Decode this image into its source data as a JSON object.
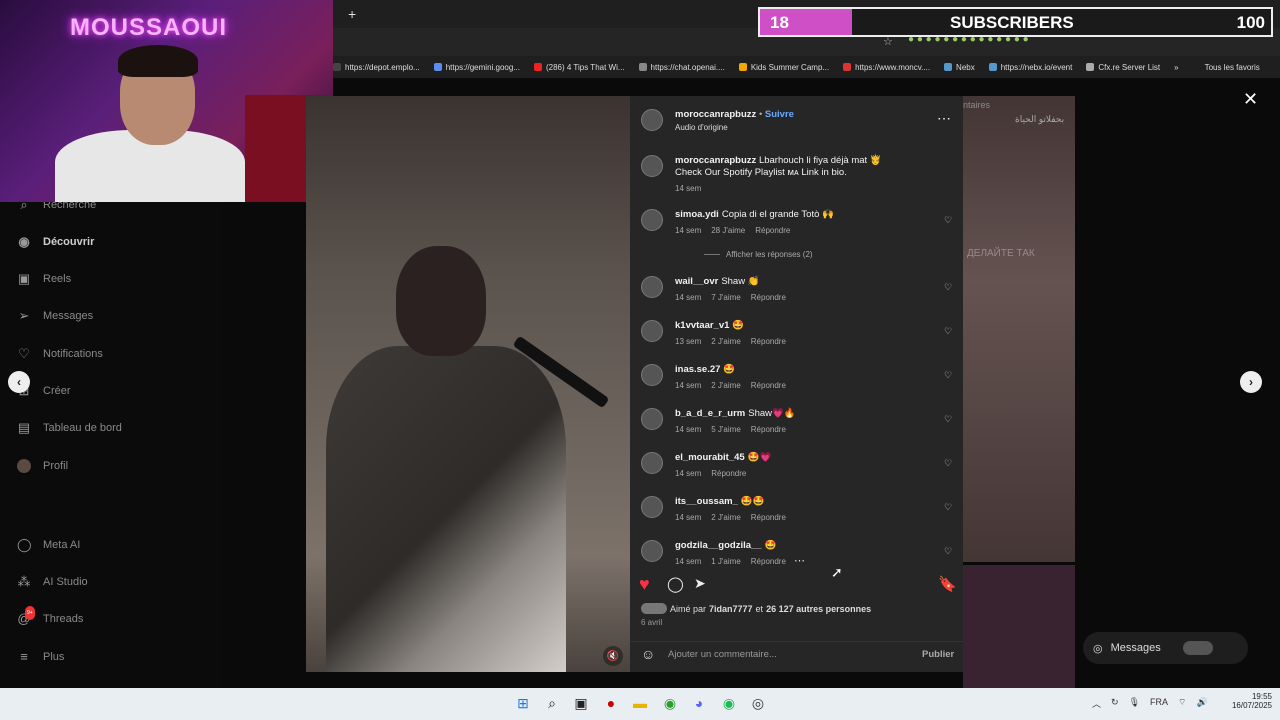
{
  "browser": {
    "new_tab": "+",
    "bookmarks": [
      {
        "label": "https://depot.emplo...",
        "color": "#444"
      },
      {
        "label": "https://gemini.goog...",
        "color": "#5b8def"
      },
      {
        "label": "(286) 4 Tips That Wi...",
        "color": "#e22"
      },
      {
        "label": "https://chat.openai....",
        "color": "#888"
      },
      {
        "label": "Kids Summer Camp...",
        "color": "#f0a800"
      },
      {
        "label": "https://www.moncv....",
        "color": "#d33"
      },
      {
        "label": "Nebx",
        "color": "#59c"
      },
      {
        "label": "https://nebx.io/event",
        "color": "#59c"
      },
      {
        "label": "Cfx.re Server List",
        "color": "#aaa"
      }
    ],
    "more_bookmarks": "»",
    "all_favorites": "Tous les favoris"
  },
  "overlay": {
    "streamer_name": "MOUSSAOUI",
    "subs_current": "18",
    "subs_label": "SUBSCRIBERS",
    "subs_goal": "100",
    "subs_fraction": 0.18
  },
  "sidebar": {
    "items": [
      {
        "label": "Recherche",
        "icon": "search-icon"
      },
      {
        "label": "Découvrir",
        "icon": "compass-icon"
      },
      {
        "label": "Reels",
        "icon": "reels-icon"
      },
      {
        "label": "Messages",
        "icon": "send-icon"
      },
      {
        "label": "Notifications",
        "icon": "heart-icon"
      },
      {
        "label": "Créer",
        "icon": "plus-icon"
      },
      {
        "label": "Tableau de bord",
        "icon": "dashboard-icon"
      },
      {
        "label": "Profil",
        "icon": "avatar-icon"
      },
      {
        "label": "Meta AI",
        "icon": "meta-ai-icon"
      },
      {
        "label": "AI Studio",
        "icon": "ai-studio-icon"
      },
      {
        "label": "Threads",
        "icon": "threads-icon",
        "badge": "9+"
      },
      {
        "label": "Plus",
        "icon": "menu-icon"
      }
    ]
  },
  "post": {
    "username": "moroccanrapbuzz",
    "follow": "Suivre",
    "separator": "•",
    "audio": "Audio d'origine",
    "caption_user": "moroccanrapbuzz",
    "caption_line1": "Lbarhouch li fiya déjà mat 🤴",
    "caption_line2": "Check Our Spotify Playlist ᴍᴀ Link in bio.",
    "caption_time": "14 sem",
    "show_replies": "Afficher les réponses (2)",
    "comments": [
      {
        "user": "simoa.ydi",
        "text": "Copia di el grande Totò 🙌",
        "time": "14 sem",
        "likes": "28 J'aime",
        "reply": "Répondre"
      },
      {
        "user": "wail__ovr",
        "text": "Shaw 👏",
        "time": "14 sem",
        "likes": "7 J'aime",
        "reply": "Répondre"
      },
      {
        "user": "k1vvtaar_v1",
        "text": "🤩",
        "time": "13 sem",
        "likes": "2 J'aime",
        "reply": "Répondre"
      },
      {
        "user": "inas.se.27",
        "text": "🤩",
        "time": "14 sem",
        "likes": "2 J'aime",
        "reply": "Répondre"
      },
      {
        "user": "b_a_d_e_r_urm",
        "text": "Shaw💗🔥",
        "time": "14 sem",
        "likes": "5 J'aime",
        "reply": "Répondre"
      },
      {
        "user": "el_mourabit_45",
        "text": "🤩💗",
        "time": "14 sem",
        "likes": "",
        "reply": "Répondre"
      },
      {
        "user": "its__oussam_",
        "text": "🤩🤩",
        "time": "14 sem",
        "likes": "2 J'aime",
        "reply": "Répondre"
      },
      {
        "user": "godzila__godzila__",
        "text": "🤩",
        "time": "14 sem",
        "likes": "1 J'aime",
        "reply": "Répondre"
      }
    ],
    "liked_prefix": "Aimé par",
    "liked_user": "7idan7777",
    "liked_and": "et",
    "liked_count": "26 127 autres personnes",
    "date": "6 avril",
    "comment_placeholder": "Ajouter un commentaire...",
    "publish": "Publier"
  },
  "background": {
    "top_text": "ntaires",
    "arabic_text": "بحفلاتو الحياة",
    "russian_text": "ДЕЛАЙТЕ ТАК"
  },
  "messages_pill": "Messages",
  "taskbar": {
    "lang": "FRA",
    "time": "19:55",
    "date": "16/07/2025"
  }
}
